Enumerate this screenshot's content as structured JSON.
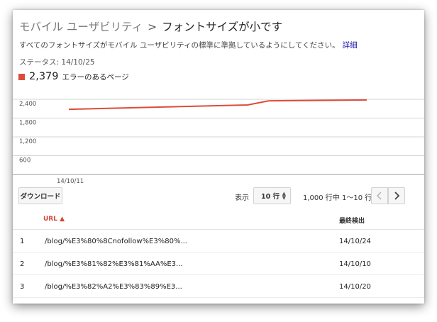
{
  "breadcrumb": {
    "parent": "モバイル ユーザビリティ",
    "separator": ">",
    "current": "フォントサイズが小です"
  },
  "description": {
    "text": "すべてのフォントサイズがモバイル ユーザビリティの標準に準拠しているようにしてください。",
    "link": "詳細"
  },
  "status": {
    "label": "ステータス:",
    "value": "14/10/25"
  },
  "legend": {
    "count": "2,379",
    "label": "エラーのあるページ",
    "color": "#dd4b39"
  },
  "chart_data": {
    "type": "line",
    "series": [
      {
        "name": "エラーのあるページ",
        "points": [
          {
            "x": "14/10/11",
            "y": 2080
          },
          {
            "x": "14/10/20",
            "y": 2220
          },
          {
            "x": "14/10/22",
            "y": 2350
          },
          {
            "x": "14/10/25",
            "y": 2379
          }
        ]
      }
    ],
    "yticks": [
      "2,400",
      "1,800",
      "1,200",
      "600"
    ],
    "ytick_values": [
      2400,
      1800,
      1200,
      600
    ],
    "xtick_labels": [
      "14/10/11"
    ],
    "ylim": [
      0,
      2400
    ],
    "grid": true,
    "line_color": "#dd4b39"
  },
  "toolbar": {
    "download_label": "ダウンロード",
    "show_label": "表示",
    "rows_value": "10 行",
    "pager_text": "1,000 行中 1〜10 行"
  },
  "table": {
    "headers": {
      "url": "URL",
      "sort_indicator": "▲",
      "date": "最終検出"
    },
    "rows": [
      {
        "index": "1",
        "url": "/blog/%E3%80%8Cnofollow%E3%80%...",
        "date": "14/10/24"
      },
      {
        "index": "2",
        "url": "/blog/%E3%81%82%E3%81%AA%E3...",
        "date": "14/10/10"
      },
      {
        "index": "3",
        "url": "/blog/%E3%82%A2%E3%83%89%E3...",
        "date": "14/10/20"
      }
    ]
  }
}
